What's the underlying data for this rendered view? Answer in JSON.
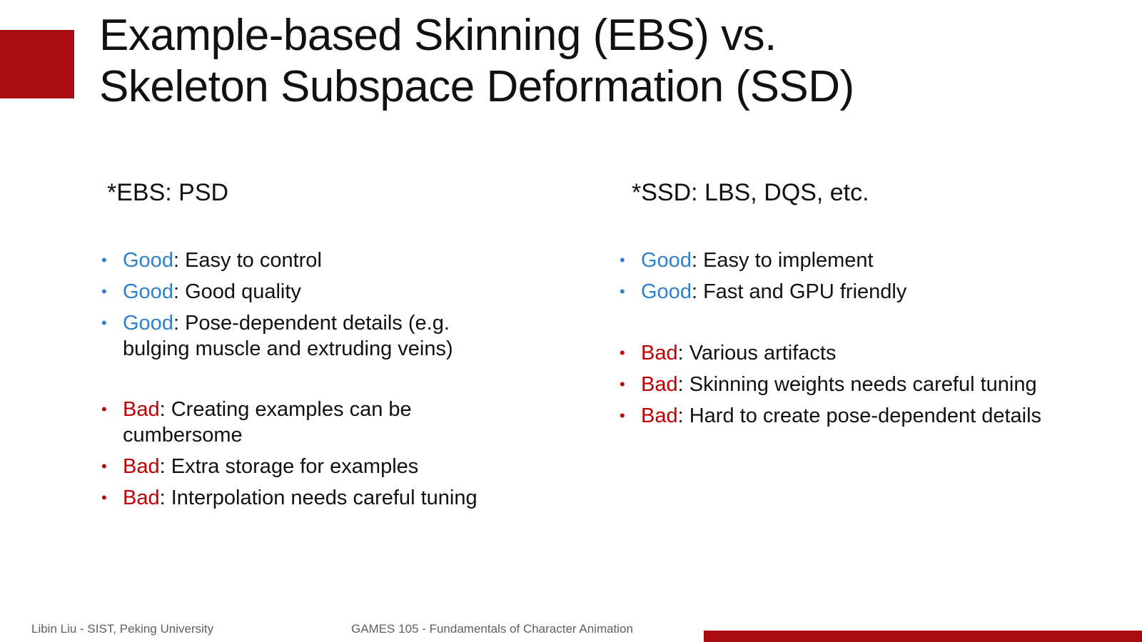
{
  "title": {
    "line1": "Example-based Skinning (EBS) vs.",
    "line2": "Skeleton Subspace Deformation (SSD)"
  },
  "left": {
    "heading": "*EBS: PSD",
    "good": [
      {
        "tag": "Good",
        "text": ": Easy to control"
      },
      {
        "tag": "Good",
        "text": ": Good quality"
      },
      {
        "tag": "Good",
        "text": ": Pose-dependent details (e.g.",
        "text2": "bulging muscle and extruding veins)"
      }
    ],
    "bad": [
      {
        "tag": "Bad",
        "text": ": Creating examples can be",
        "text2": "cumbersome"
      },
      {
        "tag": "Bad",
        "text": ": Extra storage for examples"
      },
      {
        "tag": "Bad",
        "text": ": Interpolation needs careful tuning"
      }
    ]
  },
  "right": {
    "heading": "*SSD: LBS, DQS, etc.",
    "good": [
      {
        "tag": "Good",
        "text": ": Easy to implement"
      },
      {
        "tag": "Good",
        "text": ": Fast and GPU friendly"
      }
    ],
    "bad": [
      {
        "tag": "Bad",
        "text": ": Various artifacts"
      },
      {
        "tag": "Bad",
        "text": ": Skinning weights needs careful tuning"
      },
      {
        "tag": "Bad",
        "text": ": Hard to create pose-dependent details"
      }
    ]
  },
  "footer": {
    "left": "Libin Liu - SIST, Peking University",
    "center": "GAMES 105 - Fundamentals of Character Animation"
  },
  "colors": {
    "accent": "#a80c10",
    "good": "#2f80c9",
    "bad": "#c00000",
    "bullet_symbol": "•"
  }
}
